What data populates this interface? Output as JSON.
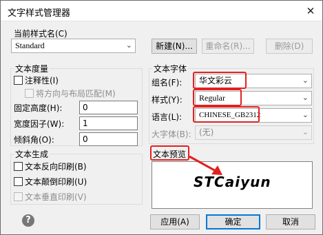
{
  "window": {
    "title": "文字样式管理器",
    "close_glyph": "✕"
  },
  "current_style": {
    "label": "当前样式名(C)",
    "value": "Standard"
  },
  "buttons": {
    "new": "新建(N)...",
    "rename": "重命名(R)...",
    "delete": "删除(D)"
  },
  "text_measure": {
    "title": "文本度量",
    "annotative_label": "注释性(I)",
    "match_layout_label": "将方向与布局匹配(M)",
    "fixed_height_label": "固定高度(H):",
    "fixed_height_value": "0",
    "width_factor_label": "宽度因子(W):",
    "width_factor_value": "1",
    "oblique_label": "倾斜角(O):",
    "oblique_value": "0"
  },
  "text_font": {
    "title": "文本字体",
    "family_label": "组名(F):",
    "family_value": "华文彩云",
    "style_label": "样式(Y):",
    "style_value": "Regular",
    "language_label": "语言(L):",
    "language_value": "CHINESE_GB2312",
    "bigfont_label": "大字体(B):",
    "bigfont_value": "(无)"
  },
  "text_generation": {
    "title": "文本生成",
    "backwards_label": "文本反向印刷(B)",
    "upside_down_label": "文本颠倒印刷(U)",
    "vertical_label": "文本垂直印刷(V)"
  },
  "preview": {
    "title": "文本预览",
    "sample": "STCaiyun"
  },
  "footer": {
    "apply": "应用(A)",
    "ok": "确定",
    "cancel": "取消",
    "help_glyph": "?"
  },
  "colors": {
    "highlight": "#e32020",
    "accent": "#0078d7"
  }
}
